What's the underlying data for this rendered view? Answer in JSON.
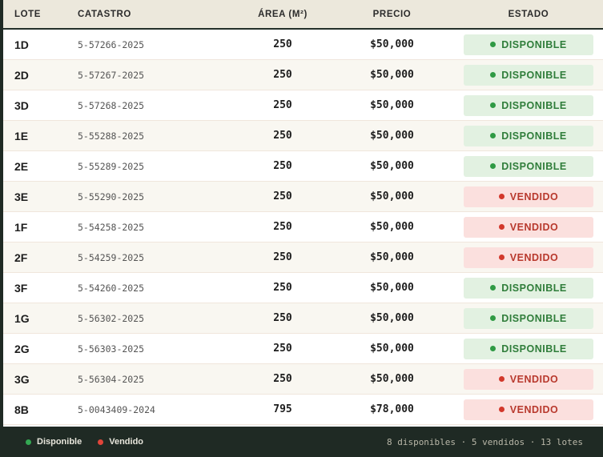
{
  "table": {
    "headers": {
      "lote": "LOTE",
      "catastro": "CATASTRO",
      "area": "ÁREA (M²)",
      "precio": "PRECIO",
      "estado": "ESTADO"
    },
    "rows": [
      {
        "lote": "1D",
        "catastro": "5-57266-2025",
        "area": "250",
        "precio": "$50,000",
        "estado": "DISPONIBLE",
        "status": "disp"
      },
      {
        "lote": "2D",
        "catastro": "5-57267-2025",
        "area": "250",
        "precio": "$50,000",
        "estado": "DISPONIBLE",
        "status": "disp"
      },
      {
        "lote": "3D",
        "catastro": "5-57268-2025",
        "area": "250",
        "precio": "$50,000",
        "estado": "DISPONIBLE",
        "status": "disp"
      },
      {
        "lote": "1E",
        "catastro": "5-55288-2025",
        "area": "250",
        "precio": "$50,000",
        "estado": "DISPONIBLE",
        "status": "disp"
      },
      {
        "lote": "2E",
        "catastro": "5-55289-2025",
        "area": "250",
        "precio": "$50,000",
        "estado": "DISPONIBLE",
        "status": "disp"
      },
      {
        "lote": "3E",
        "catastro": "5-55290-2025",
        "area": "250",
        "precio": "$50,000",
        "estado": "VENDIDO",
        "status": "vend"
      },
      {
        "lote": "1F",
        "catastro": "5-54258-2025",
        "area": "250",
        "precio": "$50,000",
        "estado": "VENDIDO",
        "status": "vend"
      },
      {
        "lote": "2F",
        "catastro": "5-54259-2025",
        "area": "250",
        "precio": "$50,000",
        "estado": "VENDIDO",
        "status": "vend"
      },
      {
        "lote": "3F",
        "catastro": "5-54260-2025",
        "area": "250",
        "precio": "$50,000",
        "estado": "DISPONIBLE",
        "status": "disp"
      },
      {
        "lote": "1G",
        "catastro": "5-56302-2025",
        "area": "250",
        "precio": "$50,000",
        "estado": "DISPONIBLE",
        "status": "disp"
      },
      {
        "lote": "2G",
        "catastro": "5-56303-2025",
        "area": "250",
        "precio": "$50,000",
        "estado": "DISPONIBLE",
        "status": "disp"
      },
      {
        "lote": "3G",
        "catastro": "5-56304-2025",
        "area": "250",
        "precio": "$50,000",
        "estado": "VENDIDO",
        "status": "vend"
      },
      {
        "lote": "8B",
        "catastro": "5-0043409-2024",
        "area": "795",
        "precio": "$78,000",
        "estado": "VENDIDO",
        "status": "vend"
      }
    ]
  },
  "footer": {
    "legend_disponible": "Disponible",
    "legend_vendido": "Vendido",
    "summary": "8 disponibles · 5 vendidos · 13 lotes"
  },
  "colors": {
    "disponible": "#2f7d3a",
    "vendido": "#b8392d",
    "footer_bg": "#1f2a24",
    "header_bg": "#ece8dc"
  }
}
